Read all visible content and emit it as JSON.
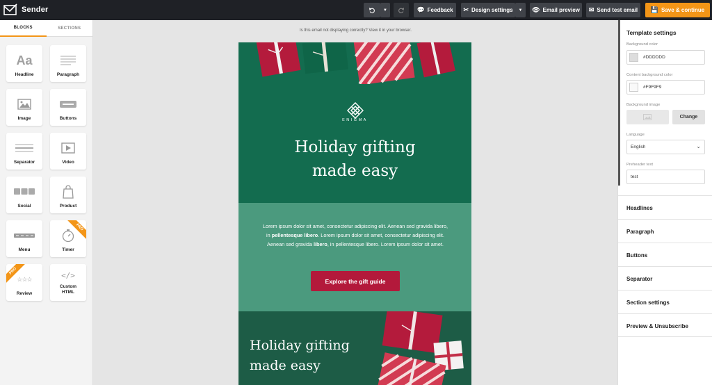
{
  "app": {
    "name": "Sender"
  },
  "toolbar": {
    "feedback": "Feedback",
    "design_settings": "Design settings",
    "email_preview": "Email preview",
    "send_test": "Send test email",
    "save_continue": "Save & continue"
  },
  "left_panel": {
    "tabs": [
      "BLOCKS",
      "SECTIONS"
    ],
    "blocks": [
      {
        "label": "Headline",
        "icon": "headline-icon"
      },
      {
        "label": "Paragraph",
        "icon": "paragraph-icon"
      },
      {
        "label": "Image",
        "icon": "image-icon"
      },
      {
        "label": "Buttons",
        "icon": "buttons-icon"
      },
      {
        "label": "Separator",
        "icon": "separator-icon"
      },
      {
        "label": "Video",
        "icon": "video-icon"
      },
      {
        "label": "Social",
        "icon": "social-icon"
      },
      {
        "label": "Product",
        "icon": "product-icon"
      },
      {
        "label": "Menu",
        "icon": "menu-icon"
      },
      {
        "label": "Timer",
        "icon": "timer-icon",
        "badge": "PRO"
      },
      {
        "label": "Review",
        "icon": "review-icon",
        "badge": "PRO"
      },
      {
        "label": "Custom HTML",
        "icon": "code-icon"
      }
    ]
  },
  "canvas": {
    "notice": "Is this email not displaying correctly? View it in your browser.",
    "hero": {
      "brand": "ENIGMA",
      "title": "Holiday gifting\nmade easy"
    },
    "body": {
      "text_1": "Lorem ipsum dolor sit amet, consectetur adipiscing elit. Aenean sed gravida libero, in ",
      "bold_1": "pellentesque libero",
      "text_2": ". Lorem ipsum dolor sit amet, consectetur adipiscing elit. Aenean sed gravida ",
      "bold_2": "libero",
      "text_3": ", in pellentesque libero. Lorem ipsum dolor sit amet.",
      "cta": "Explore the gift guide"
    },
    "footer_section": {
      "title": "Holiday gifting\nmade easy"
    }
  },
  "right_panel": {
    "title": "Template settings",
    "background_color_label": "Background color",
    "background_color": "#DDDDDD",
    "content_bg_label": "Content background color",
    "content_bg": "#F9F9F9",
    "bg_image_label": "Background image",
    "change_label": "Change",
    "language_label": "Language",
    "language": "English",
    "preheader_label": "Preheader text",
    "preheader": "test",
    "sections": [
      "Headlines",
      "Paragraph",
      "Buttons",
      "Separator",
      "Section settings",
      "Preview & Unsubscribe"
    ]
  },
  "colors": {
    "accent": "#F39517",
    "hero_green": "#136C4F",
    "body_green": "#4B9A7E",
    "cta_red": "#B3193B"
  }
}
